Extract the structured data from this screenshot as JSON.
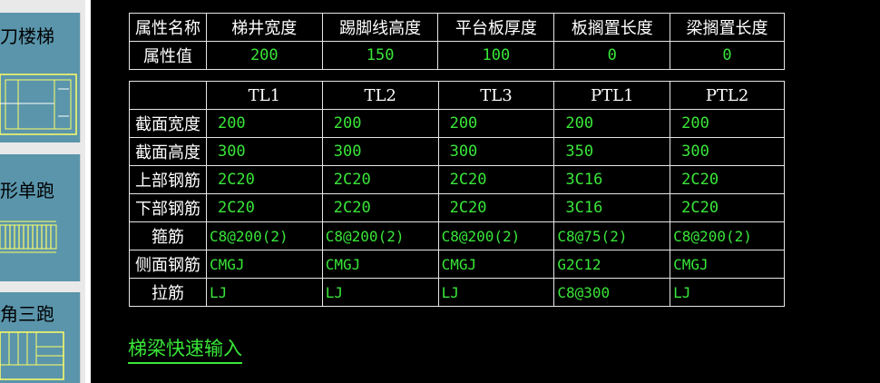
{
  "sidebar": {
    "items": [
      {
        "label": "刀楼梯"
      },
      {
        "label": "形单跑"
      },
      {
        "label": "角三跑"
      }
    ]
  },
  "property_table": {
    "header_label": "属性名称",
    "value_label": "属性值",
    "columns": [
      "梯井宽度",
      "踢脚线高度",
      "平台板厚度",
      "板搁置长度",
      "梁搁置长度"
    ],
    "values": [
      "200",
      "150",
      "100",
      "0",
      "0"
    ]
  },
  "beam_table": {
    "columns": [
      "TL1",
      "TL2",
      "TL3",
      "PTL1",
      "PTL2"
    ],
    "rows": [
      {
        "label": "截面宽度",
        "cells": [
          "200",
          "200",
          "200",
          "200",
          "200"
        ]
      },
      {
        "label": "截面高度",
        "cells": [
          "300",
          "300",
          "300",
          "350",
          "300"
        ]
      },
      {
        "label": "上部钢筋",
        "cells": [
          "2C20",
          "2C20",
          "2C20",
          "3C16",
          "2C20"
        ]
      },
      {
        "label": "下部钢筋",
        "cells": [
          "2C20",
          "2C20",
          "2C20",
          "3C16",
          "2C20"
        ]
      },
      {
        "label": "箍筋",
        "cells": [
          "C8@200(2)",
          "C8@200(2)",
          "C8@200(2)",
          "C8@75(2)",
          "C8@200(2)"
        ]
      },
      {
        "label": "侧面钢筋",
        "cells": [
          "CMGJ",
          "CMGJ",
          "CMGJ",
          "G2C12",
          "CMGJ"
        ]
      },
      {
        "label": "拉筋",
        "cells": [
          "LJ",
          "LJ",
          "LJ",
          "C8@300",
          "LJ"
        ]
      }
    ]
  },
  "quick_input": {
    "label": "梯梁快速输入"
  },
  "colors": {
    "accent_green": "#39e639",
    "thumb_bg": "#5a95ab",
    "background": "#000000"
  }
}
